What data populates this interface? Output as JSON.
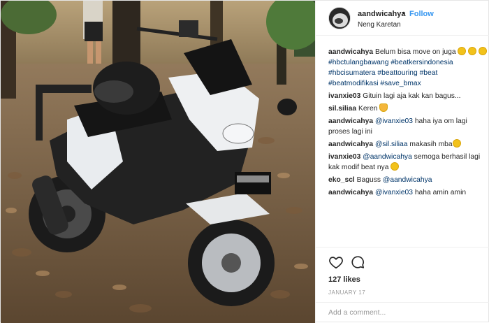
{
  "post": {
    "author": {
      "username": "aandwicahya",
      "separator": "•",
      "follow_label": "Follow",
      "location": "Neng Karetan"
    },
    "caption": {
      "username": "aandwicahya",
      "text_parts": [
        "Belum bisa move on juga ",
        "#hbctulangbawang",
        " ",
        "#beatkersindonesia",
        "#hbcisumatera",
        " ",
        "#beattouring",
        " ",
        "#beat",
        "#beatmodifikasi",
        " ",
        "#save_bmax"
      ]
    },
    "comments": [
      {
        "username": "ivanxie03",
        "text": "Gituin lagi aja kak kan bagus..."
      },
      {
        "username": "sil.siliaa",
        "text": "Keren "
      },
      {
        "username": "aandwicahya",
        "mention": "@ivanxie03",
        "text": " haha iya om lagi proses lagi ini"
      },
      {
        "username": "aandwicahya",
        "mention": "@sil.siliaa",
        "text": " makasih mba"
      },
      {
        "username": "ivanxie03",
        "mention": "@aandwicahya",
        "text": " semoga berhasil lagi kak modif beat nya "
      },
      {
        "username": "eko_scl",
        "text": "Baguss ",
        "mention_after": "@aandwicahya"
      },
      {
        "username": "aandwicahya",
        "mention": "@ivanxie03",
        "text": " haha amin amin"
      }
    ],
    "likes": "127 likes",
    "date": "January 17",
    "add_comment_placeholder": "Add a comment..."
  },
  "icons": {
    "like": "heart-icon",
    "comment": "comment-icon"
  },
  "colors": {
    "link": "#3897f0",
    "hashtag": "#003569",
    "border": "#efefef",
    "muted": "#999999"
  }
}
